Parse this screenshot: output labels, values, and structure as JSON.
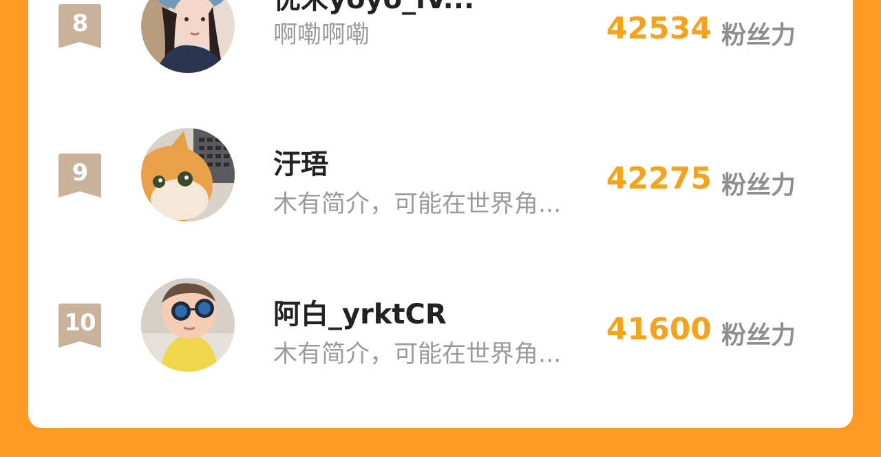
{
  "ranking": {
    "score_unit": "粉丝力",
    "badge_color": "#C9B29C",
    "score_color": "#F7A21B",
    "entries": [
      {
        "rank": "8",
        "name": "优米yoyo_iV...",
        "bio": "啊嘞啊嘞",
        "score": "42534",
        "avatar_icon": "girl-with-cap-avatar"
      },
      {
        "rank": "9",
        "name": "汙珸",
        "bio": "木有简介，可能在世界角...",
        "score": "42275",
        "avatar_icon": "orange-cat-avatar"
      },
      {
        "rank": "10",
        "name": "阿白_yrktCR",
        "bio": "木有简介，可能在世界角...",
        "score": "41600",
        "avatar_icon": "baby-with-sunglasses-avatar"
      }
    ]
  }
}
